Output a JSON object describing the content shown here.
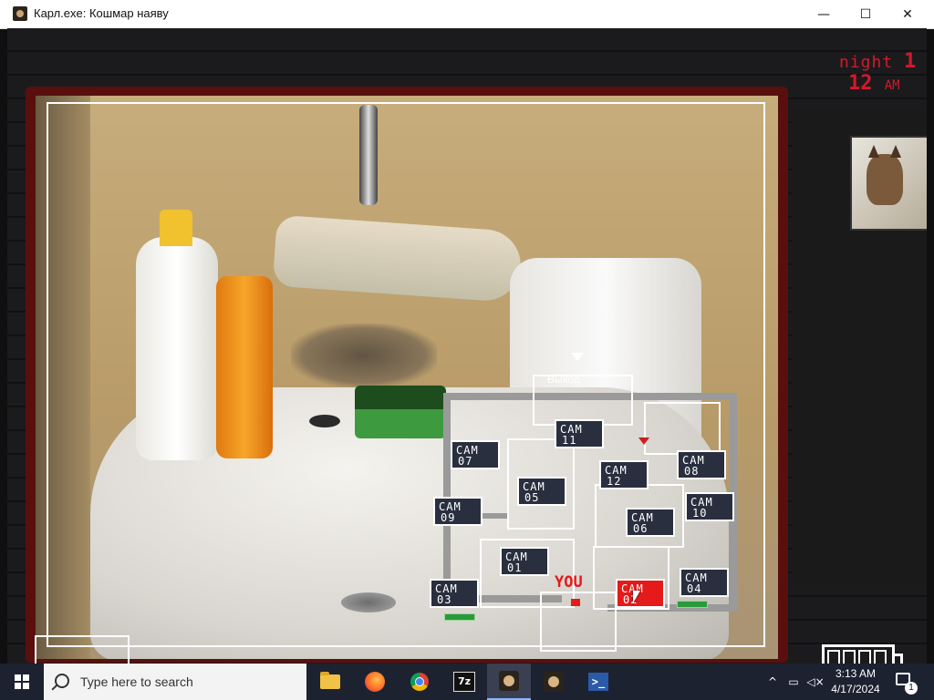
{
  "window": {
    "title": "Карл.exe: Кошмар наяву",
    "min_glyph": "—",
    "max_glyph": "☐",
    "close_glyph": "✕"
  },
  "hud": {
    "night_label": "night",
    "night_number": "1",
    "hour": "12",
    "meridiem": "AM"
  },
  "map": {
    "exit_label": "Выход",
    "you_label": "YOU",
    "active_camera": "CAM 02",
    "cameras": [
      {
        "label": "CAM",
        "number": "11"
      },
      {
        "label": "CAM",
        "number": "07"
      },
      {
        "label": "CAM",
        "number": "12"
      },
      {
        "label": "CAM",
        "number": "08"
      },
      {
        "label": "CAM",
        "number": "05"
      },
      {
        "label": "CAM",
        "number": "09"
      },
      {
        "label": "CAM",
        "number": "10"
      },
      {
        "label": "CAM",
        "number": "06"
      },
      {
        "label": "CAM",
        "number": "01"
      },
      {
        "label": "CAM",
        "number": "04"
      },
      {
        "label": "CAM",
        "number": "03"
      },
      {
        "label": "CAM",
        "number": "02"
      }
    ]
  },
  "taskbar": {
    "search_placeholder": "Type here to search",
    "apps": [
      "file-explorer",
      "firefox",
      "chrome",
      "7-zip",
      "karl-exe",
      "karl-exe",
      "powershell"
    ],
    "zip_label": "7z",
    "ps_label": ">_",
    "time": "3:13 AM",
    "date": "4/17/2024",
    "notification_count": "1"
  },
  "colors": {
    "hud_red": "#d4192b",
    "active_cam": "#e51a1a",
    "cam_button": "#2a2f3f",
    "taskbar": "#1d2230"
  }
}
